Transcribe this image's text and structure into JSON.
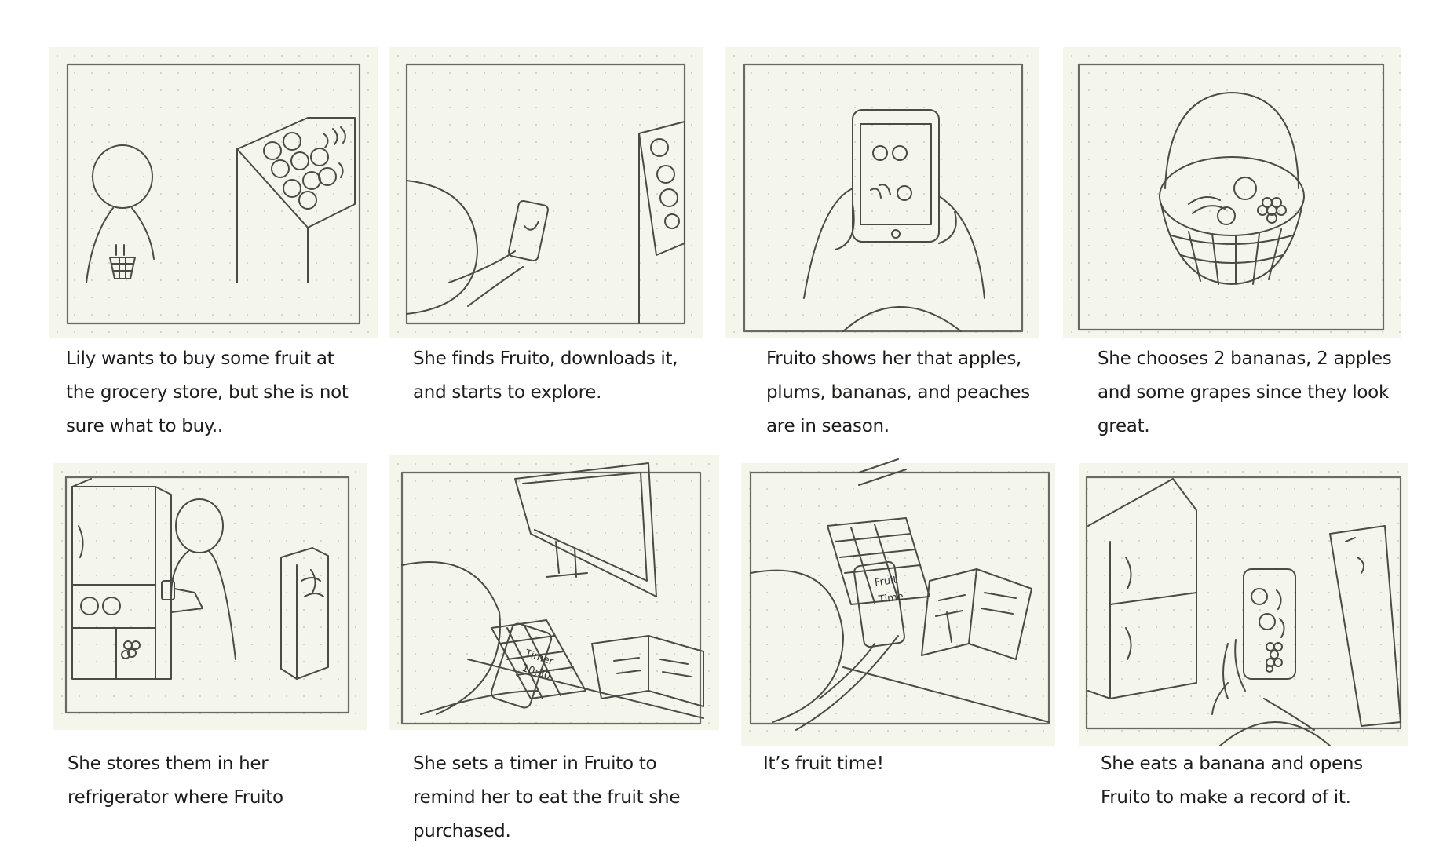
{
  "storyboard": {
    "panels": [
      {
        "caption": "Lily wants to buy some fruit at the grocery store, but she is not sure what to buy.."
      },
      {
        "caption": "She finds Fruito, downloads it, and starts to explore."
      },
      {
        "caption": "Fruito shows her that apples, plums, bananas, and peaches are in season."
      },
      {
        "caption": "She chooses 2 bananas, 2 apples and some grapes since they look great."
      },
      {
        "caption": "She stores them in her refrigerator where Fruito"
      },
      {
        "caption": "She sets a timer in Fruito to remind her to eat the fruit she purchased."
      },
      {
        "caption": "It’s fruit time!"
      },
      {
        "caption": "She eats a banana and opens Fruito to make a record of it."
      }
    ],
    "phone_labels": {
      "timer": "Timer",
      "timer_value": "10:30",
      "fruit_time_1": "Fruit",
      "fruit_time_2": "Time"
    }
  }
}
